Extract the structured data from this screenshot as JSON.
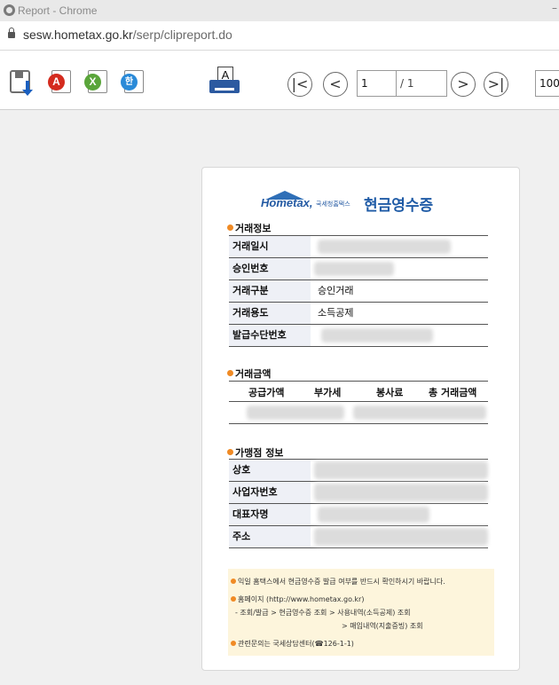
{
  "browser": {
    "window_title": "Report - Chrome",
    "url_host": "sesw.hometax.go.kr",
    "url_path": "/serp/clipreport.do",
    "minimize_glyph": "–"
  },
  "toolbar": {
    "print_glyph": "A",
    "current_page": "1",
    "total_pages": "/ 1",
    "zoom": "100",
    "first_glyph": "|<",
    "prev_glyph": "<",
    "next_glyph": ">",
    "last_glyph": ">|",
    "pdf_glyph": "A",
    "xls_glyph": "X",
    "hwp_glyph": "한"
  },
  "receipt": {
    "logo_text": "Hometax,",
    "logo_sub": "국세청홈택스",
    "title": "현금영수증",
    "transaction_info": {
      "section": "거래정보",
      "rows": [
        {
          "label": "거래일시",
          "value": ""
        },
        {
          "label": "승인번호",
          "value": ""
        },
        {
          "label": "거래구분",
          "value": "승인거래"
        },
        {
          "label": "거래용도",
          "value": "소득공제"
        },
        {
          "label": "발급수단번호",
          "value": ""
        }
      ]
    },
    "amount": {
      "section": "거래금액",
      "columns": [
        "공급가액",
        "부가세",
        "봉사료",
        "총 거래금액"
      ]
    },
    "merchant": {
      "section": "가맹점 정보",
      "rows": [
        {
          "label": "상호"
        },
        {
          "label": "사업자번호"
        },
        {
          "label": "대표자명"
        },
        {
          "label": "주소"
        }
      ]
    },
    "notice": {
      "line1": "익일 홈택스에서 현금영수증 발급 여부를 반드시 확인하시기 바랍니다.",
      "line2": "홈페이지 (http://www.hometax.go.kr)",
      "line3": "- 조회/발급 > 현금영수증 조회 > 사용내역(소득공제) 조회",
      "line4": "> 매입내역(지출증빙) 조회",
      "line5": "관련문의는 국세상담센터(☎126-1-1)"
    }
  }
}
